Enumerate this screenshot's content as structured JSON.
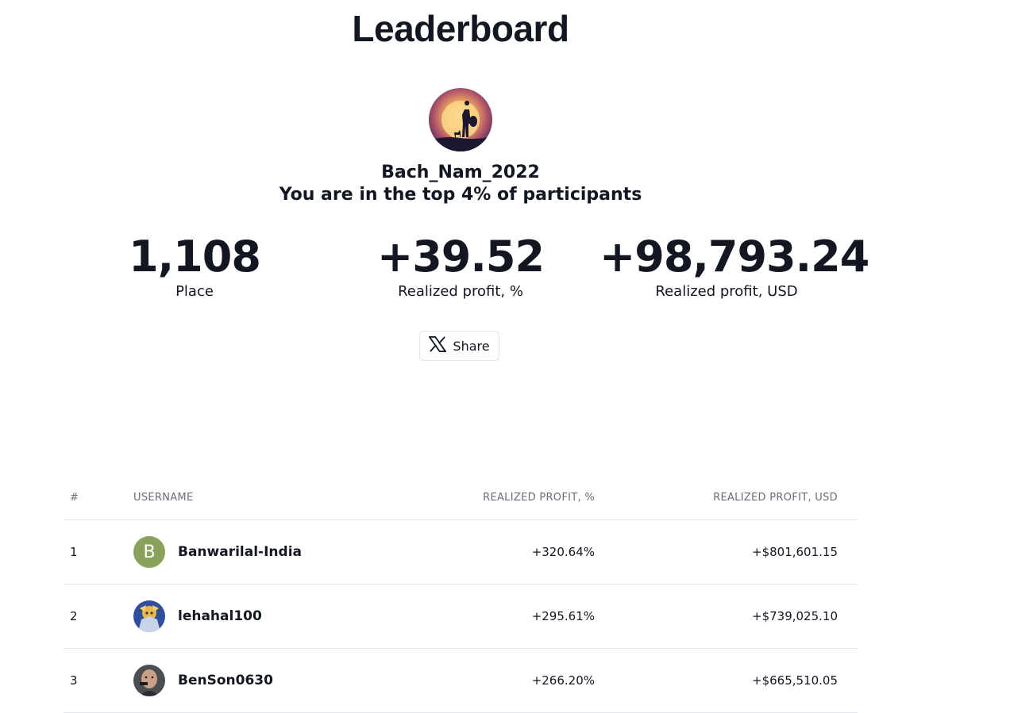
{
  "page": {
    "title": "Leaderboard"
  },
  "profile": {
    "username": "Bach_Nam_2022",
    "rank_text": "You are in the top 4% of participants",
    "stats": {
      "place_value": "1,108",
      "place_label": "Place",
      "pct_value": "+39.52",
      "pct_label": "Realized profit, %",
      "usd_value": "+98,793.24",
      "usd_label": "Realized profit, USD"
    },
    "share_label": "Share",
    "share_icon": "x-logo-icon"
  },
  "table": {
    "headers": {
      "rank": "#",
      "username": "USERNAME",
      "pct": "REALIZED PROFIT, %",
      "usd": "REALIZED PROFIT, USD"
    },
    "rows": [
      {
        "rank": "1",
        "avatar_letter": "B",
        "avatar_color": "#8aa15e",
        "username": "Banwarilal-India",
        "pct": "+320.64%",
        "usd": "+$801,601.15"
      },
      {
        "rank": "2",
        "avatar_letter": "",
        "username": "lehahal100",
        "pct": "+295.61%",
        "usd": "+$739,025.10"
      },
      {
        "rank": "3",
        "avatar_letter": "",
        "username": "BenSon0630",
        "pct": "+266.20%",
        "usd": "+$665,510.05"
      }
    ]
  }
}
